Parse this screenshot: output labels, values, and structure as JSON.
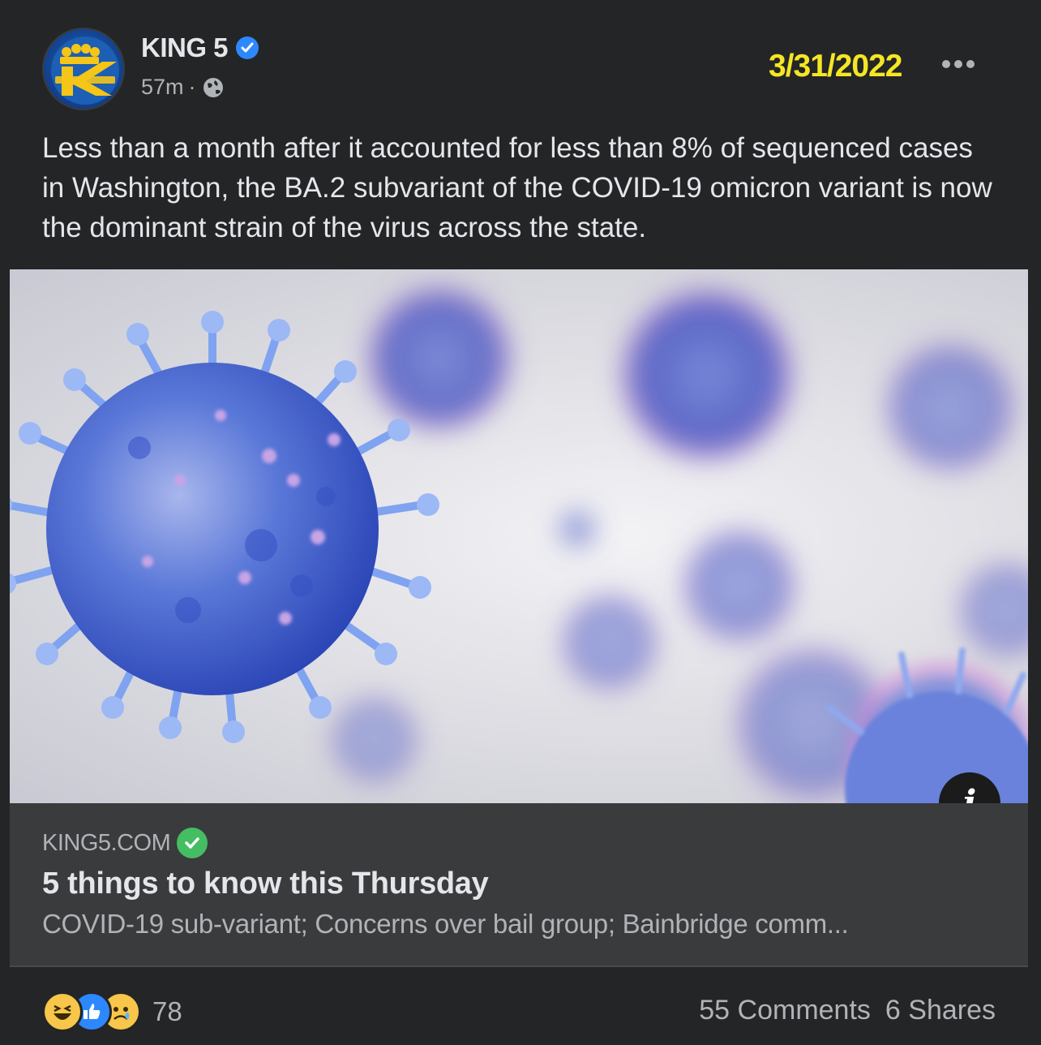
{
  "post": {
    "page_name": "KING 5",
    "timestamp": "57m",
    "separator": "·",
    "date_stamp": "3/31/2022",
    "body": "Less than a month after it accounted for less than 8% of sequenced cases in Washington, the BA.2 subvariant of the COVID-19 omicron variant is now the dominant strain of the virus across the state."
  },
  "link": {
    "domain": "KING5.COM",
    "title": "5 things to know this Thursday",
    "description": "COVID-19 sub-variant; Concerns over bail group; Bainbridge comm..."
  },
  "footer": {
    "reactions": [
      "haha",
      "like",
      "sad"
    ],
    "reaction_count": "78",
    "comments": "55 Comments",
    "shares": "6 Shares"
  },
  "icons": {
    "verified": "verified-badge-icon",
    "privacy": "globe-icon",
    "more": "more-options-icon",
    "info": "info-icon"
  },
  "colors": {
    "background": "#242526",
    "date_stamp": "#f5e625",
    "verified": "#2d88ff",
    "domain_check": "#45bd62"
  }
}
